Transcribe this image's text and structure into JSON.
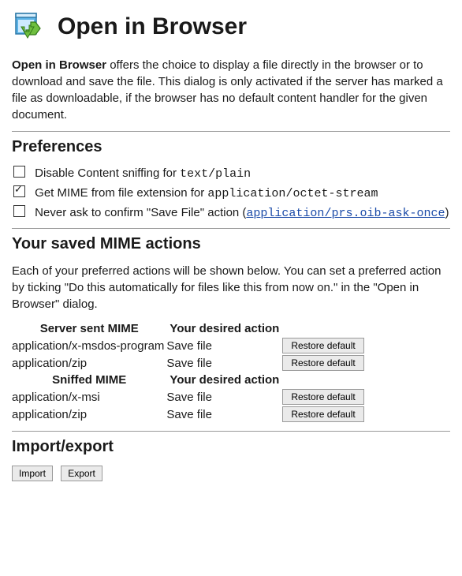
{
  "header": {
    "title": "Open in Browser"
  },
  "intro": {
    "strong": "Open in Browser",
    "rest": " offers the choice to display a file directly in the browser or to download and save the file. This dialog is only activated if the server has marked a file as downloadable, if the browser has no default content handler for the given document."
  },
  "prefs": {
    "heading": "Preferences",
    "items": [
      {
        "checked": false,
        "pre": "Disable Content sniffing for ",
        "code": "text/plain",
        "post": ""
      },
      {
        "checked": true,
        "pre": "Get MIME from file extension for ",
        "code": "application/octet-stream",
        "post": ""
      },
      {
        "checked": false,
        "pre": "Never ask to confirm \"Save File\" action (",
        "link": "application/prs.oib-ask-once",
        "post": ")"
      }
    ]
  },
  "saved": {
    "heading": "Your saved MIME actions",
    "desc": "Each of your preferred actions will be shown below. You can set a preferred action by ticking \"Do this automatically for files like this from now on.\" in the \"Open in Browser\" dialog.",
    "table1": {
      "col1": "Server sent MIME",
      "col2": "Your desired action",
      "rows": [
        {
          "mime": "application/x-msdos-program",
          "action": "Save file",
          "btn": "Restore default"
        },
        {
          "mime": "application/zip",
          "action": "Save file",
          "btn": "Restore default"
        }
      ]
    },
    "table2": {
      "col1": "Sniffed MIME",
      "col2": "Your desired action",
      "rows": [
        {
          "mime": "application/x-msi",
          "action": "Save file",
          "btn": "Restore default"
        },
        {
          "mime": "application/zip",
          "action": "Save file",
          "btn": "Restore default"
        }
      ]
    }
  },
  "io": {
    "heading": "Import/export",
    "import_btn": "Import",
    "export_btn": "Export"
  }
}
